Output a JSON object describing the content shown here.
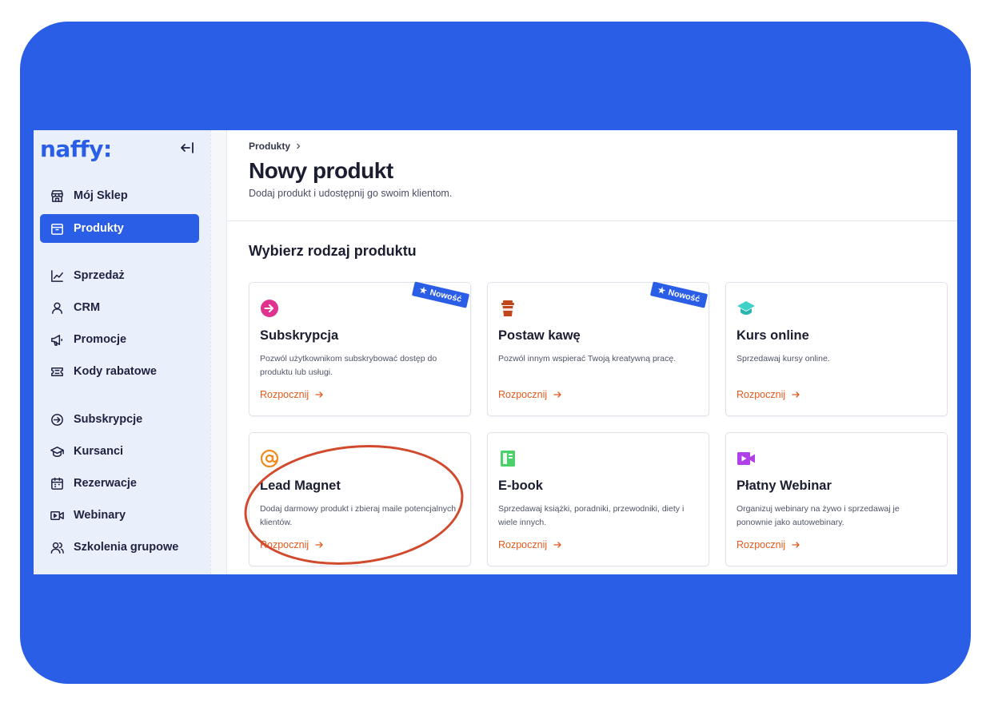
{
  "sidebar": {
    "logo": "naffy:",
    "items": [
      {
        "label": "Mój Sklep"
      },
      {
        "label": "Produkty"
      },
      {
        "label": "Sprzedaż"
      },
      {
        "label": "CRM"
      },
      {
        "label": "Promocje"
      },
      {
        "label": "Kody rabatowe"
      },
      {
        "label": "Subskrypcje"
      },
      {
        "label": "Kursanci"
      },
      {
        "label": "Rezerwacje"
      },
      {
        "label": "Webinary"
      },
      {
        "label": "Szkolenia grupowe"
      }
    ],
    "active_item": "Produkty"
  },
  "header": {
    "breadcrumb": "Produkty",
    "title": "Nowy produkt",
    "subtitle": "Dodaj produkt i udostępnij go swoim klientom."
  },
  "section_title": "Wybierz rodzaj produktu",
  "cards": [
    {
      "title": "Subskrypcja",
      "description": "Pozwól użytkownikom subskrybować dostęp do produktu lub usługi.",
      "cta": "Rozpocznij",
      "badge": "Nowość",
      "icon": "subscription-icon",
      "icon_color": "#e0338f"
    },
    {
      "title": "Postaw kawę",
      "description": "Pozwól innym wspierać Twoją kreatywną pracę.",
      "cta": "Rozpocznij",
      "badge": "Nowość",
      "icon": "coffee-cup-icon",
      "icon_color": "#c2461b"
    },
    {
      "title": "Kurs online",
      "description": "Sprzedawaj kursy online.",
      "cta": "Rozpocznij",
      "icon": "graduation-cap-icon",
      "icon_color": "#3fd0c9"
    },
    {
      "title": "Lead Magnet",
      "description": "Dodaj darmowy produkt i zbieraj maile potencjalnych klientów.",
      "cta": "Rozpocznij",
      "icon": "at-sign-icon",
      "icon_color": "#f08a1e"
    },
    {
      "title": "E-book",
      "description": "Sprzedawaj książki, poradniki, przewodniki, diety i wiele innych.",
      "cta": "Rozpocznij",
      "icon": "ebook-icon",
      "icon_color": "#4cd06a"
    },
    {
      "title": "Płatny Webinar",
      "description": "Organizuj webinary na żywo i sprzedawaj je ponownie jako autowebinary.",
      "cta": "Rozpocznij",
      "icon": "video-camera-icon",
      "icon_color": "#b040e8"
    }
  ],
  "colors": {
    "brand": "#2b5ee6",
    "accent": "#e25a1c",
    "highlight_circle": "#d24a2e"
  }
}
